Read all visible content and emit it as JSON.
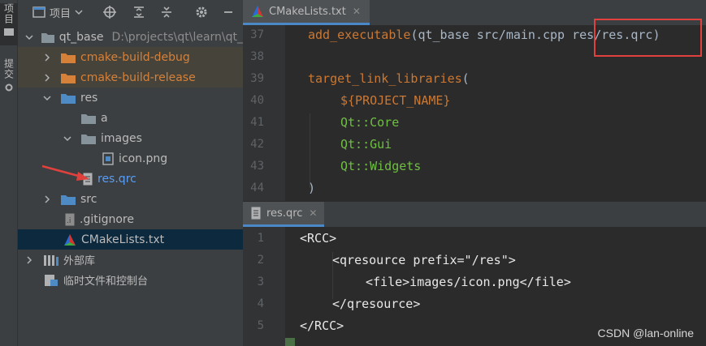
{
  "sidebar": {
    "project_tab": "项目",
    "commit_tab": "提交"
  },
  "project_panel": {
    "title": "项目",
    "tree": [
      {
        "label": "qt_base",
        "path": "D:\\projects\\qt\\learn\\qt_",
        "type": "root"
      },
      {
        "label": "cmake-build-debug",
        "type": "folder-excluded"
      },
      {
        "label": "cmake-build-release",
        "type": "folder-excluded"
      },
      {
        "label": "res",
        "type": "folder"
      },
      {
        "label": "a",
        "type": "folder"
      },
      {
        "label": "images",
        "type": "folder"
      },
      {
        "label": "icon.png",
        "type": "image-file"
      },
      {
        "label": "res.qrc",
        "type": "qrc-file"
      },
      {
        "label": "src",
        "type": "folder"
      },
      {
        "label": ".gitignore",
        "type": "file"
      },
      {
        "label": "CMakeLists.txt",
        "type": "cmake-file",
        "selected": true
      },
      {
        "label": "外部库",
        "type": "library"
      },
      {
        "label": "临时文件和控制台",
        "type": "scratch"
      }
    ]
  },
  "editor_top": {
    "tab": "CMakeLists.txt",
    "lines": [
      {
        "n": "37",
        "parts": [
          "add_executable",
          "(qt_base src/main.cpp ",
          "res/res.qrc",
          ")"
        ]
      },
      {
        "n": "38",
        "parts": []
      },
      {
        "n": "39",
        "parts": [
          "target_link_libraries",
          "("
        ]
      },
      {
        "n": "40",
        "parts": [
          "${PROJECT_NAME}"
        ]
      },
      {
        "n": "41",
        "parts": [
          "Qt::Core"
        ]
      },
      {
        "n": "42",
        "parts": [
          "Qt::Gui"
        ]
      },
      {
        "n": "43",
        "parts": [
          "Qt::Widgets"
        ]
      },
      {
        "n": "44",
        "parts": [
          ")"
        ]
      }
    ]
  },
  "editor_bottom": {
    "tab": "res.qrc",
    "lines": [
      {
        "n": "1",
        "text": "<RCC>"
      },
      {
        "n": "2",
        "text": "<qresource prefix=\"/res\">"
      },
      {
        "n": "3",
        "text": "<file>images/icon.png</file>"
      },
      {
        "n": "4",
        "text": "</qresource>"
      },
      {
        "n": "5",
        "text": "</RCC>"
      }
    ]
  },
  "watermark": "CSDN @lan-online",
  "colors": {
    "accent_blue": "#4a88c7",
    "highlight_red": "#e0413c",
    "excluded_orange": "#d6813a",
    "cmake_green": "#6fbf42"
  }
}
